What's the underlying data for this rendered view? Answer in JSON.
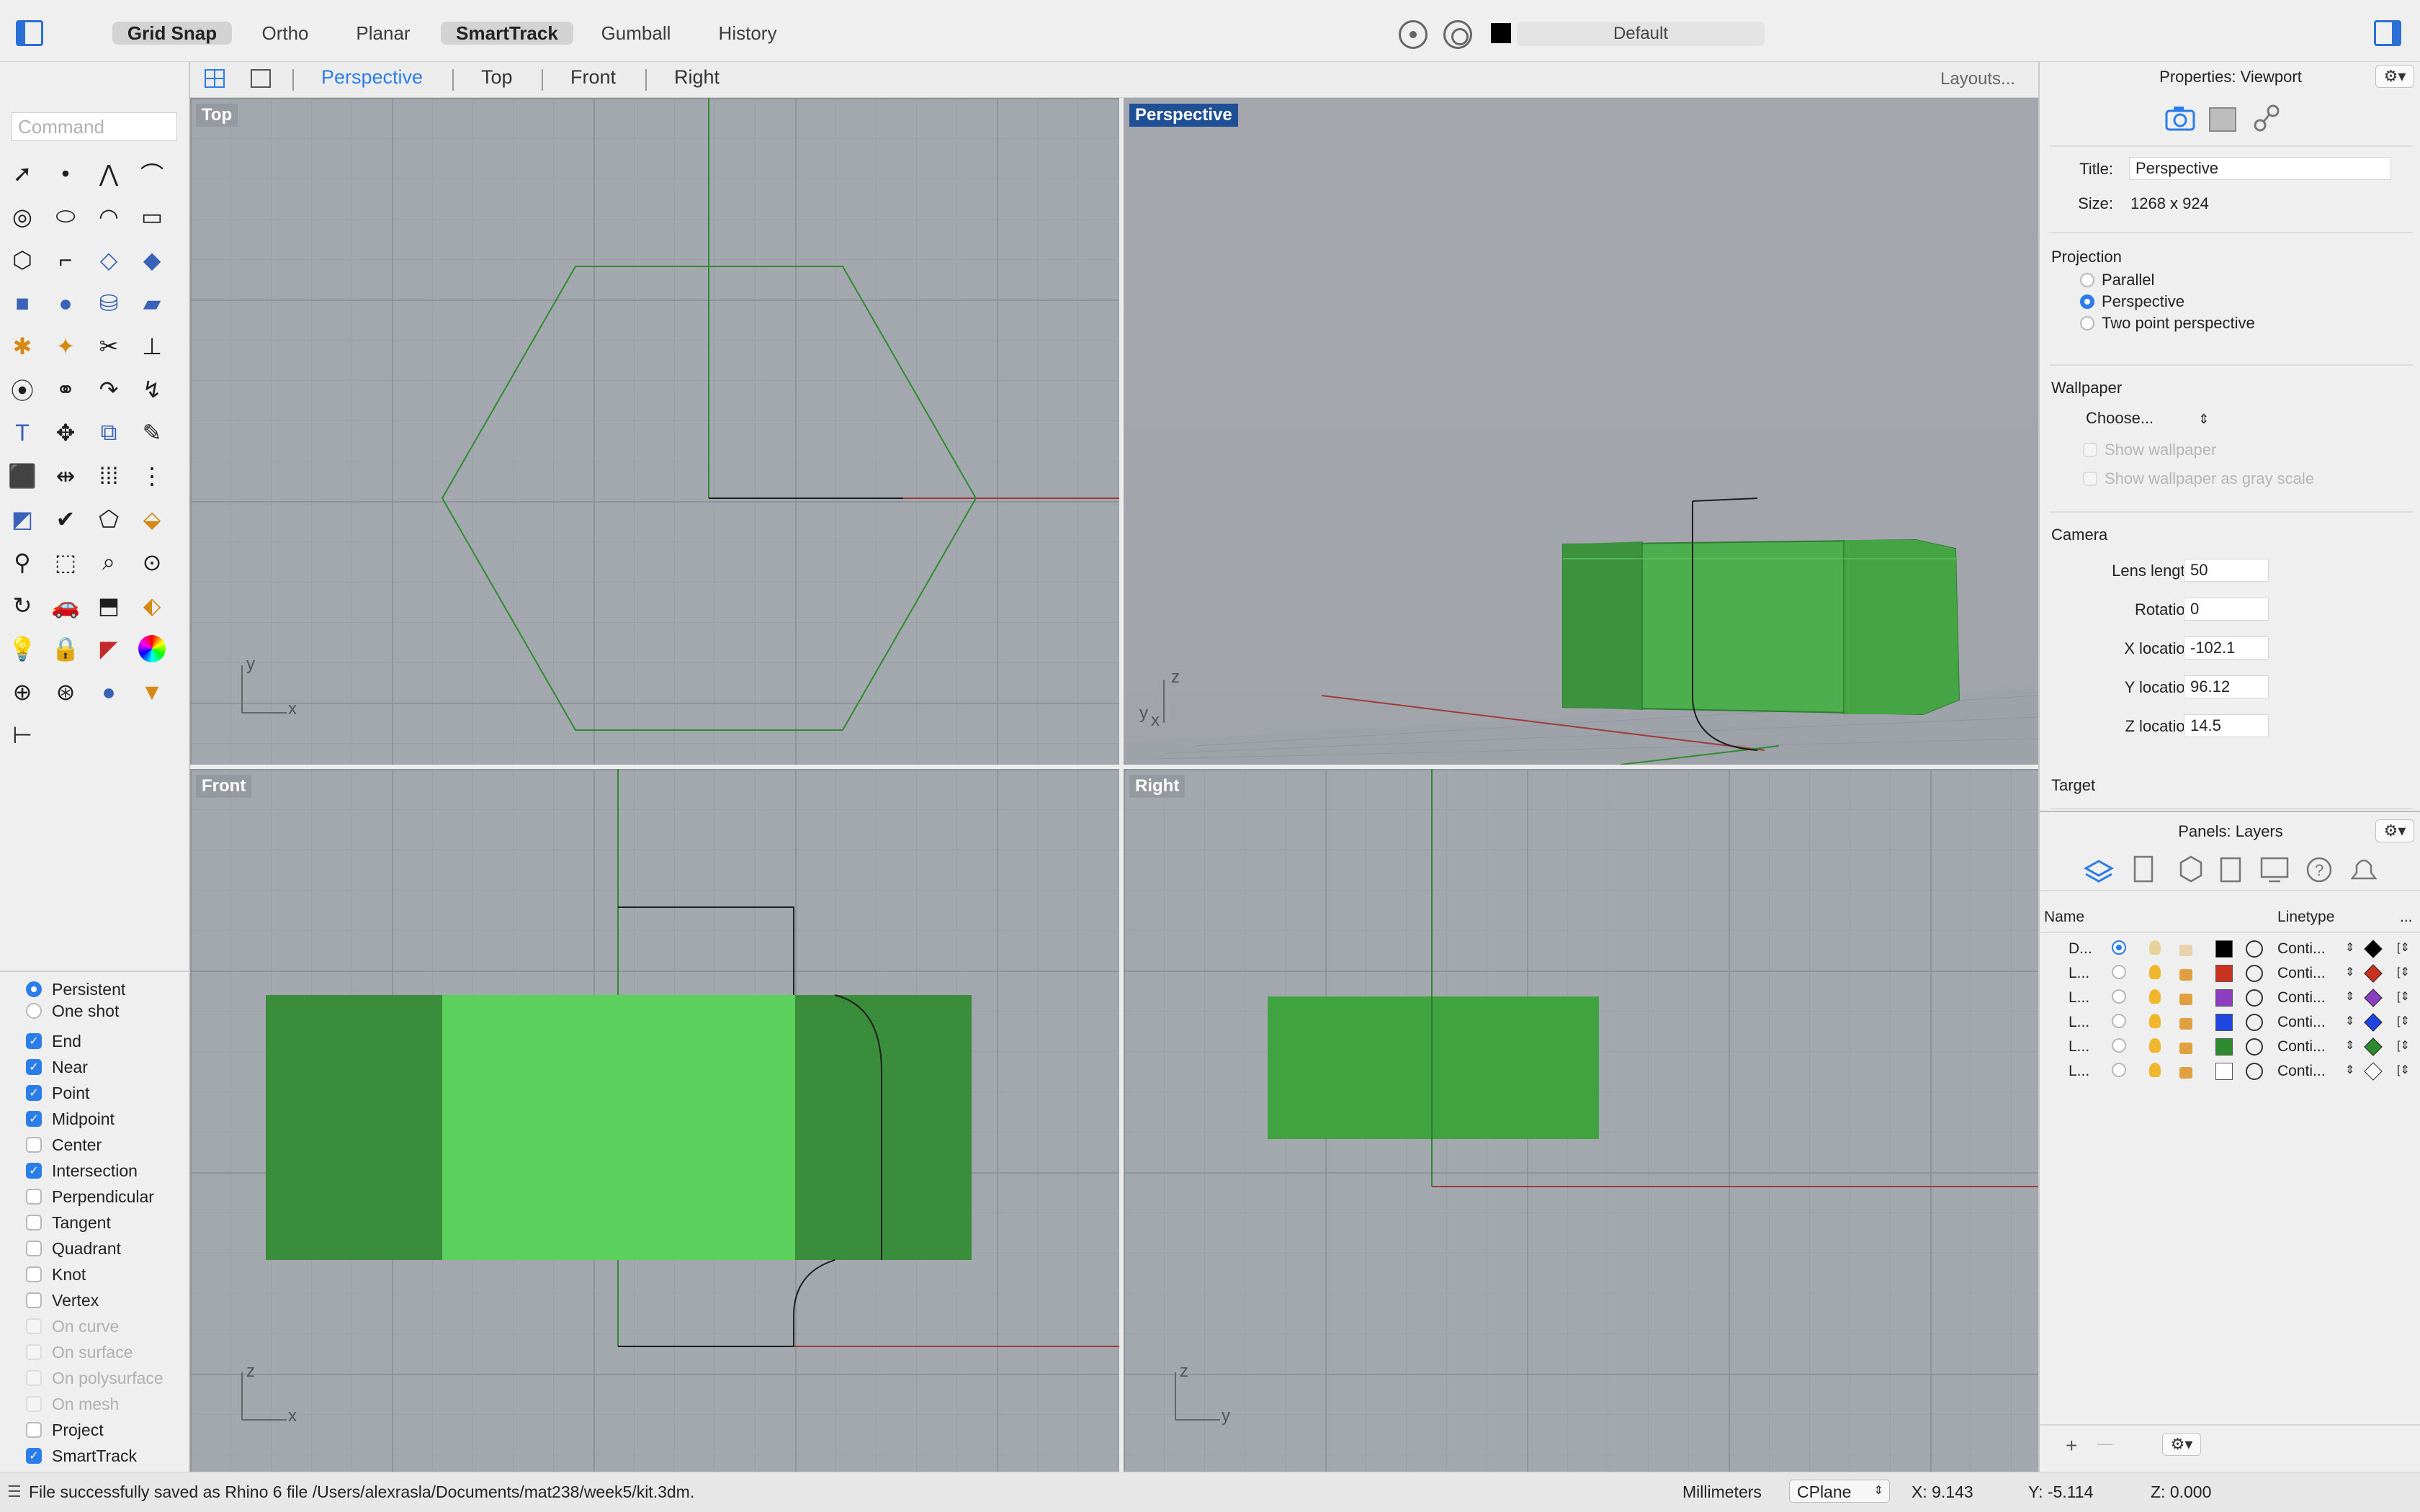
{
  "toolbar": {
    "toggles": [
      {
        "label": "Grid Snap",
        "on": true
      },
      {
        "label": "Ortho",
        "on": false
      },
      {
        "label": "Planar",
        "on": false
      },
      {
        "label": "SmartTrack",
        "on": true
      },
      {
        "label": "Gumball",
        "on": false
      },
      {
        "label": "History",
        "on": false
      }
    ],
    "current_layer": "Default",
    "layer_color": "#000000"
  },
  "command": {
    "placeholder": "Command"
  },
  "viewport_tabs": {
    "tabs": [
      "Perspective",
      "Top",
      "Front",
      "Right"
    ],
    "active": "Perspective",
    "layouts_label": "Layouts..."
  },
  "viewports": {
    "top": {
      "label": "Top",
      "axis_x": "x",
      "axis_y": "y"
    },
    "perspective": {
      "label": "Perspective",
      "axis_z": "z",
      "axis_y": "y",
      "axis_x": "x"
    },
    "front": {
      "label": "Front",
      "axis_x": "x",
      "axis_z": "z"
    },
    "right": {
      "label": "Right",
      "axis_y": "y",
      "axis_z": "z"
    }
  },
  "osnap": {
    "mode_persistent": "Persistent",
    "mode_oneshot": "One shot",
    "items": [
      {
        "label": "End",
        "checked": true,
        "enabled": true
      },
      {
        "label": "Near",
        "checked": true,
        "enabled": true
      },
      {
        "label": "Point",
        "checked": true,
        "enabled": true
      },
      {
        "label": "Midpoint",
        "checked": true,
        "enabled": true
      },
      {
        "label": "Center",
        "checked": false,
        "enabled": true
      },
      {
        "label": "Intersection",
        "checked": true,
        "enabled": true
      },
      {
        "label": "Perpendicular",
        "checked": false,
        "enabled": true
      },
      {
        "label": "Tangent",
        "checked": false,
        "enabled": true
      },
      {
        "label": "Quadrant",
        "checked": false,
        "enabled": true
      },
      {
        "label": "Knot",
        "checked": false,
        "enabled": true
      },
      {
        "label": "Vertex",
        "checked": false,
        "enabled": true
      },
      {
        "label": "On curve",
        "checked": false,
        "enabled": false
      },
      {
        "label": "On surface",
        "checked": false,
        "enabled": false
      },
      {
        "label": "On polysurface",
        "checked": false,
        "enabled": false
      },
      {
        "label": "On mesh",
        "checked": false,
        "enabled": false
      },
      {
        "label": "Project",
        "checked": false,
        "enabled": true
      },
      {
        "label": "SmartTrack",
        "checked": true,
        "enabled": true
      }
    ]
  },
  "properties": {
    "panel_title": "Properties: Viewport",
    "title_label": "Title:",
    "title_value": "Perspective",
    "size_label": "Size:",
    "size_value": "1268 x 924",
    "projection_title": "Projection",
    "projection_options": [
      "Parallel",
      "Perspective",
      "Two point perspective"
    ],
    "projection_selected": "Perspective",
    "wallpaper_title": "Wallpaper",
    "wallpaper_choose": "Choose...",
    "show_wallpaper": "Show wallpaper",
    "show_gray": "Show wallpaper as gray scale",
    "camera_title": "Camera",
    "camera_fields": [
      {
        "label": "Lens length:",
        "value": "50"
      },
      {
        "label": "Rotation:",
        "value": "0"
      },
      {
        "label": "X location:",
        "value": "-102.1"
      },
      {
        "label": "Y location:",
        "value": "96.12"
      },
      {
        "label": "Z location:",
        "value": "14.5"
      }
    ],
    "target_title": "Target"
  },
  "layers": {
    "panel_title": "Panels: Layers",
    "col_name": "Name",
    "col_linetype": "Linetype",
    "col_more": "...",
    "rows": [
      {
        "name": "D...",
        "current": true,
        "color": "#000000",
        "linetype": "Conti...",
        "print": "#000000"
      },
      {
        "name": "L...",
        "current": false,
        "color": "#c8321e",
        "linetype": "Conti...",
        "print": "#c8321e"
      },
      {
        "name": "L...",
        "current": false,
        "color": "#8b3fc0",
        "linetype": "Conti...",
        "print": "#8b3fc0"
      },
      {
        "name": "L...",
        "current": false,
        "color": "#1f45e0",
        "linetype": "Conti...",
        "print": "#1f45e0"
      },
      {
        "name": "L...",
        "current": false,
        "color": "#2e8a2e",
        "linetype": "Conti...",
        "print": "#2e8a2e"
      },
      {
        "name": "L...",
        "current": false,
        "color": "#ffffff",
        "linetype": "Conti...",
        "print": "#ffffff"
      }
    ],
    "add_label": "+",
    "remove_label": "—"
  },
  "status": {
    "message": "File successfully saved as Rhino 6 file /Users/alexrasla/Documents/mat238/week5/kit.3dm.",
    "units": "Millimeters",
    "cplane": "CPlane",
    "x": "X: 9.143",
    "y": "Y: -5.114",
    "z": "Z: 0.000"
  }
}
